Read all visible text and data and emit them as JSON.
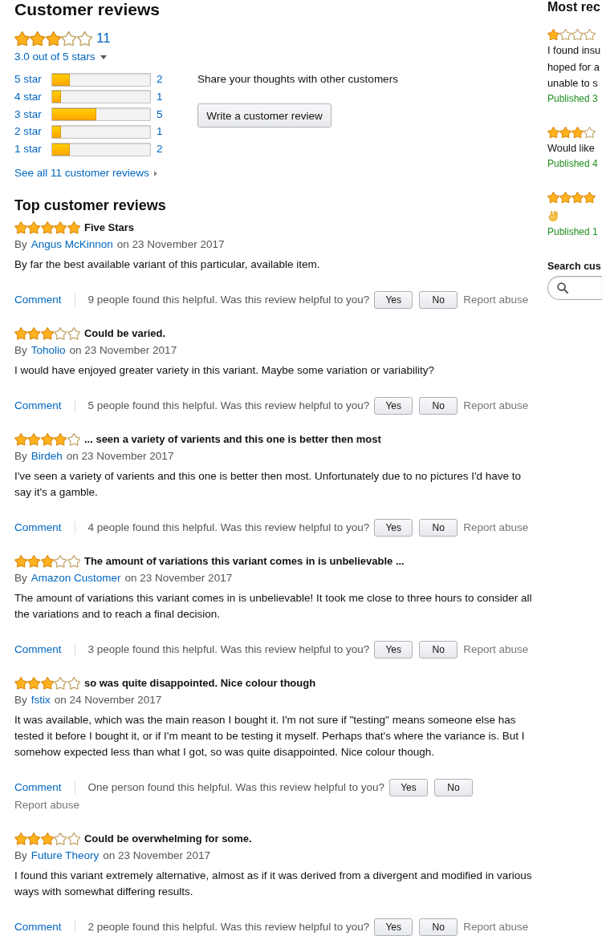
{
  "summary": {
    "title": "Customer reviews",
    "stars": 3,
    "count": "11",
    "rating_text": "3.0 out of 5 stars"
  },
  "histogram": [
    {
      "label": "5 star",
      "level": 0.18,
      "count": "2"
    },
    {
      "label": "4 star",
      "level": 0.09,
      "count": "1"
    },
    {
      "label": "3 star",
      "level": 0.45,
      "count": "5"
    },
    {
      "label": "2 star",
      "level": 0.09,
      "count": "1"
    },
    {
      "label": "1 star",
      "level": 0.18,
      "count": "2"
    }
  ],
  "share": {
    "text": "Share your thoughts with other customers",
    "button": "Write a customer review"
  },
  "see_all": "See all 11 customer reviews",
  "top_reviews": {
    "title": "Top customer reviews",
    "reviews": [
      {
        "stars": 5,
        "title": "Five Stars",
        "by": "By",
        "author": "Angus McKinnon",
        "date": "on 23 November 2017",
        "body": "By far the best available variant of this particular, available item.",
        "comment": "Comment",
        "helpful": "9 people found this helpful. Was this review helpful to you?",
        "yes": "Yes",
        "no": "No",
        "report": "Report abuse"
      },
      {
        "stars": 3,
        "title": "Could be varied.",
        "by": "By",
        "author": "Toholio",
        "date": "on 23 November 2017",
        "body": "I would have enjoyed greater variety in this variant. Maybe some variation or variability?",
        "comment": "Comment",
        "helpful": "5 people found this helpful. Was this review helpful to you?",
        "yes": "Yes",
        "no": "No",
        "report": "Report abuse"
      },
      {
        "stars": 4,
        "title": "... seen a variety of varients and this one is better then most",
        "by": "By",
        "author": "Birdeh",
        "date": "on 23 November 2017",
        "body": "I've seen a variety of varients and this one is better then most. Unfortunately due to no pictures I'd have to say it's a gamble.",
        "comment": "Comment",
        "helpful": "4 people found this helpful. Was this review helpful to you?",
        "yes": "Yes",
        "no": "No",
        "report": "Report abuse"
      },
      {
        "stars": 3,
        "title": "The amount of variations this variant comes in is unbelievable ...",
        "by": "By",
        "author": "Amazon Customer",
        "date": "on 23 November 2017",
        "body": "The amount of variations this variant comes in is unbelievable! It took me close to three hours to consider all the variations and to reach a final decision.",
        "comment": "Comment",
        "helpful": "3 people found this helpful. Was this review helpful to you?",
        "yes": "Yes",
        "no": "No",
        "report": "Report abuse"
      },
      {
        "stars": 3,
        "title": "so was quite disappointed. Nice colour though",
        "by": "By",
        "author": "fstix",
        "date": "on 24 November 2017",
        "body": "It was available, which was the main reason I bought it. I'm not sure if \"testing\" means someone else has tested it before I bought it, or if I'm meant to be testing it myself. Perhaps that's where the variance is. But I somehow expected less than what I got, so was quite disappointed. Nice colour though.",
        "comment": "Comment",
        "helpful": "One person found this helpful. Was this review helpful to you?",
        "yes": "Yes",
        "no": "No",
        "report": "Report abuse"
      },
      {
        "stars": 3,
        "title": "Could be overwhelming for some.",
        "by": "By",
        "author": "Future Theory",
        "date": "on 23 November 2017",
        "body": "I found this variant extremely alternative, almost as if it was derived from a divergent and modified in various ways with somewhat differing results.",
        "comment": "Comment",
        "helpful": "2 people found this helpful. Was this review helpful to you?",
        "yes": "Yes",
        "no": "No",
        "report": "Report abuse"
      }
    ]
  },
  "most_recent": {
    "title": "Most rec",
    "items": [
      {
        "kind": "text",
        "stars": 1,
        "lines": [
          "I found insu",
          "hoped for a",
          "unable to s"
        ],
        "published": "Published 3"
      },
      {
        "kind": "text",
        "stars": 3,
        "lines": [
          "Would like"
        ],
        "published": "Published 4"
      },
      {
        "kind": "emoji",
        "stars": 4,
        "published": "Published 1"
      }
    ]
  },
  "search": {
    "title": "Search cus"
  }
}
